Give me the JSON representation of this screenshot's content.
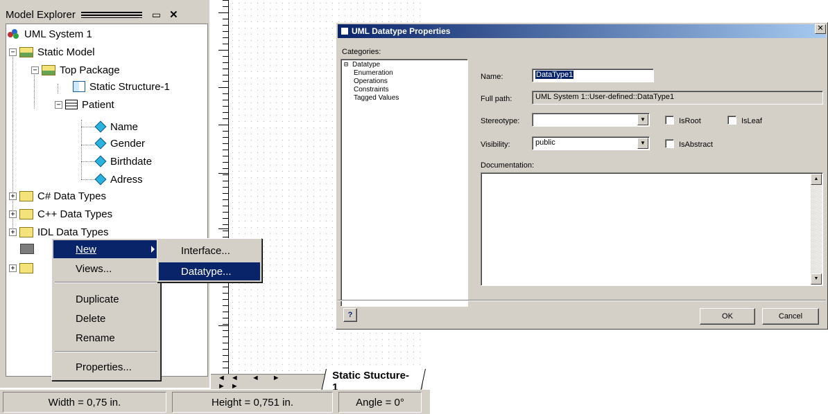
{
  "explorer": {
    "title": "Model Explorer",
    "tree": [
      {
        "label": "UML System 1"
      },
      {
        "label": "Static Model"
      },
      {
        "label": "Top Package"
      },
      {
        "label": "Static Structure-1"
      },
      {
        "label": "Patient"
      },
      {
        "label": "Name"
      },
      {
        "label": "Gender"
      },
      {
        "label": "Birthdate"
      },
      {
        "label": "Adress"
      },
      {
        "label": "C# Data Types"
      },
      {
        "label": "C++ Data Types"
      },
      {
        "label": "IDL Data Types"
      }
    ]
  },
  "context_menu": {
    "items": [
      "New",
      "Views...",
      "Duplicate",
      "Delete",
      "Rename",
      "Properties..."
    ],
    "submenu": [
      "Interface...",
      "Datatype..."
    ]
  },
  "diagram": {
    "tab_label": "Static Stucture-1",
    "nav_glyphs": "◄◄ ◄ ► ►►"
  },
  "statusbar": {
    "width": "Width = 0,75 in.",
    "height": "Height = 0,751 in.",
    "angle": "Angle = 0°"
  },
  "dialog": {
    "title": "UML Datatype Properties",
    "categories_label": "Categories:",
    "categories": [
      "Datatype",
      "Enumeration",
      "Operations",
      "Constraints",
      "Tagged Values"
    ],
    "name_label": "Name:",
    "name_value": "DataType1",
    "fullpath_label": "Full path:",
    "fullpath_value": "UML System 1::User-defined::DataType1",
    "stereotype_label": "Stereotype:",
    "stereotype_value": "",
    "isroot_label": "IsRoot",
    "isleaf_label": "IsLeaf",
    "visibility_label": "Visibility:",
    "visibility_value": "public",
    "isabstract_label": "IsAbstract",
    "documentation_label": "Documentation:",
    "documentation_value": "",
    "ok_label": "OK",
    "cancel_label": "Cancel",
    "colors": {
      "title_bar": "#0a246a",
      "selection": "#0a246a"
    }
  }
}
